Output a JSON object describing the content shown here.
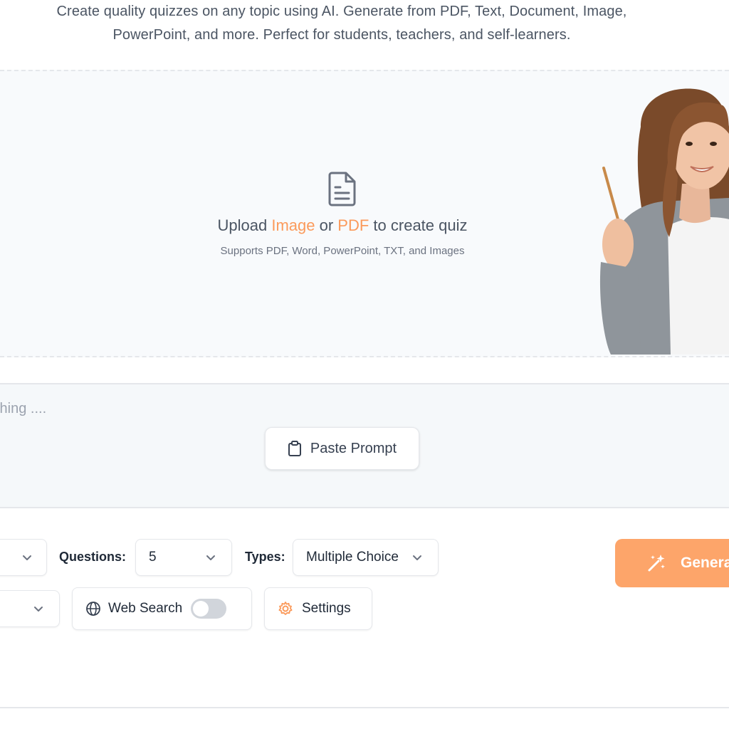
{
  "header": {
    "subtitle_line1": "Create quality quizzes on any topic using AI. Generate from PDF, Text, Document, Image,",
    "subtitle_line2": "PowerPoint, and more. Perfect for students, teachers, and self-learners."
  },
  "upload": {
    "title_prefix": "Upload",
    "title_image": "Image",
    "title_or": "or",
    "title_pdf": "PDF",
    "title_suffix": "to create quiz",
    "supported": "Supports PDF, Word, PowerPoint, TXT, and Images",
    "accent_color": "#fb9a5b"
  },
  "prompt": {
    "placeholder": "thing ....",
    "paste_label": "Paste Prompt"
  },
  "controls": {
    "questions_label": "Questions:",
    "questions_value": "5",
    "types_label": "Types:",
    "types_value": "Multiple Choice",
    "web_search_label": "Web Search",
    "web_search_enabled": false,
    "settings_label": "Settings",
    "generate_label": "Genera"
  },
  "icons": {
    "upload": "document-icon",
    "paste": "clipboard-icon",
    "web": "globe-icon",
    "settings": "gear-icon",
    "generate": "magic-wand-icon"
  }
}
